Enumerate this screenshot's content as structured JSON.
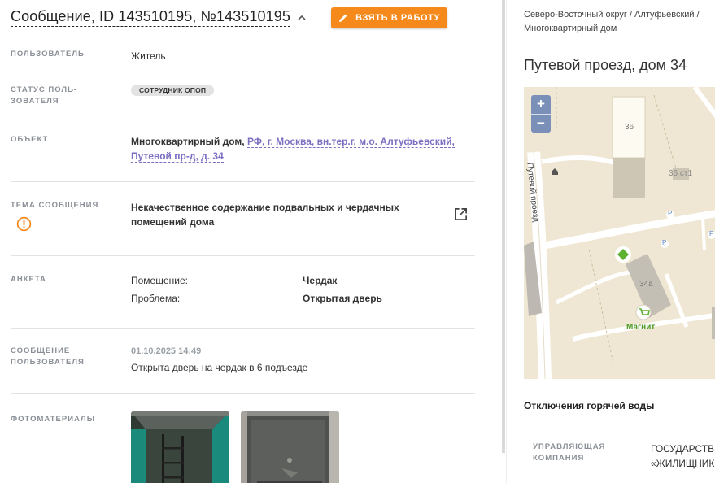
{
  "header": {
    "title": "Сообщение, ID 143510195, №143510195",
    "action_label": "ВЗЯТЬ В РАБОТУ"
  },
  "fields": {
    "user": {
      "label": "ПОЛЬЗОВАТЕЛЬ",
      "value": "Житель"
    },
    "user_status": {
      "label_line1": "СТАТУС ПОЛЬ-",
      "label_line2": "ЗОВАТЕЛЯ",
      "badge": "СОТРУДНИК ОПОП"
    },
    "object": {
      "label": "ОБЪЕКТ",
      "type": "Многоквартирный дом,",
      "address_line1": "РФ, г. Москва, вн.тер.г. м.о. Алтуфьевский,",
      "address_line2": "Путевой пр-д, д. 34"
    },
    "topic": {
      "label": "ТЕМА СООБЩЕНИЯ",
      "value_line1": "Некачественное содержание подвальных и чердачных",
      "value_line2": "помещений дома"
    },
    "survey": {
      "label": "АНКЕТА",
      "rows": [
        {
          "key": "Помещение:",
          "value": "Чердак"
        },
        {
          "key": "Проблема:",
          "value": "Открытая дверь"
        }
      ]
    },
    "user_message": {
      "label_line1": "СООБЩЕНИЕ",
      "label_line2": "ПОЛЬЗОВАТЕЛЯ",
      "date": "01.10.2025 14:49",
      "text": "Открыта дверь на чердак в 6 подъезде"
    },
    "photos": {
      "label": "ФОТОМАТЕРИАЛЫ"
    }
  },
  "right": {
    "breadcrumb_line1": "Северо-Восточный округ / Алтуфьевский /",
    "breadcrumb_line2": "Многоквартирный дом",
    "address": "Путевой проезд, дом 34",
    "map": {
      "zoom_in": "+",
      "zoom_out": "−",
      "street": "Путевой проезд",
      "b36": "36",
      "b36s1": "36 ст1",
      "b34a": "34а",
      "shop": "Магнит",
      "parking": "P"
    },
    "hot_water": "Отключения горячей воды",
    "uk": {
      "label_line1": "УПРАВЛЯЮЩАЯ",
      "label_line2": "КОМПАНИЯ",
      "value_line1": "ГОСУДАРСТВЕННОЕ",
      "value_line2": "«ЖИЛИЩНИК"
    }
  },
  "colors": {
    "accent": "#f5891c",
    "link": "#7b6fc2",
    "warning": "#f5891c"
  },
  "icons": [
    "pencil-icon",
    "chevron-up-icon",
    "warning-icon",
    "external-link-icon"
  ]
}
